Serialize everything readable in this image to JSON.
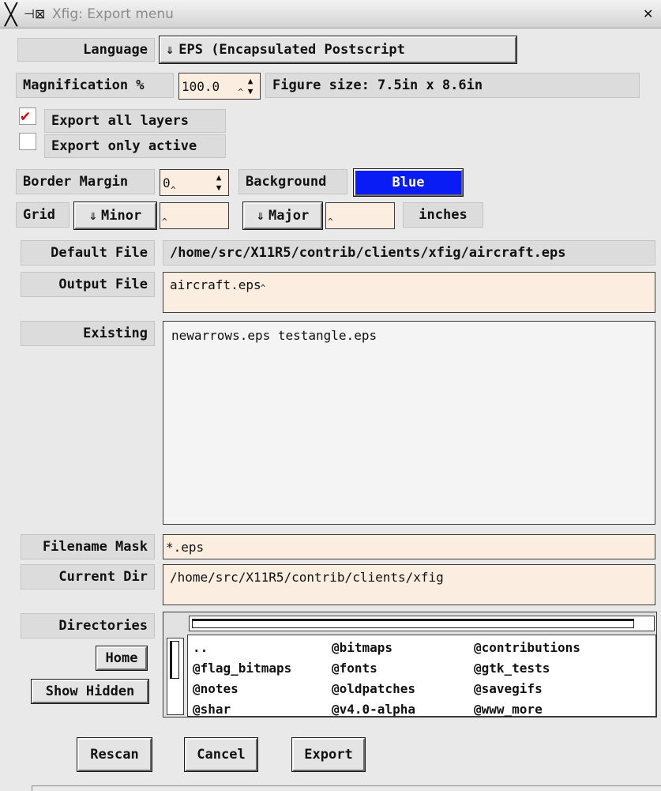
{
  "window": {
    "title": "Xfig: Export menu",
    "close_glyph": "✕",
    "app_icon": "x-logo-icon",
    "sticky_icon": "pin-icon"
  },
  "language": {
    "label": "Language",
    "value": "EPS (Encapsulated Postscript",
    "menu_icon": "menu-arrow-down-icon"
  },
  "magnification": {
    "label": "Magnification %",
    "value": "100.0",
    "figure_size": "Figure size: 7.5in x 8.6in"
  },
  "layers": {
    "export_all_label": "Export all layers",
    "export_all_checked": true,
    "export_active_label": "Export only active",
    "export_active_checked": false,
    "check_color": "#d81010"
  },
  "border": {
    "label": "Border Margin",
    "value": "0"
  },
  "background": {
    "label": "Background",
    "value": "Blue",
    "color": "#0a1cf5"
  },
  "grid": {
    "label": "Grid",
    "minor_label": "Minor",
    "minor_value": "",
    "major_label": "Major",
    "major_value": "",
    "units": "inches"
  },
  "files": {
    "default_label": "Default File",
    "default_value": "/home/src/X11R5/contrib/clients/xfig/aircraft.eps",
    "output_label": "Output File",
    "output_value": "aircraft.eps",
    "existing_label": "Existing",
    "existing_value": "newarrows.eps testangle.eps",
    "mask_label": "Filename Mask",
    "mask_value": "*.eps",
    "curdir_label": "Current Dir",
    "curdir_value": "/home/src/X11R5/contrib/clients/xfig"
  },
  "directories": {
    "label": "Directories",
    "home_label": "Home",
    "show_hidden_label": "Show Hidden",
    "items": [
      "..",
      "@bitmaps",
      "@contributions",
      "@flag_bitmaps",
      "@fonts",
      "@gtk_tests",
      "@notes",
      "@oldpatches",
      "@savegifs",
      "@shar",
      "@v4.0-alpha",
      "@www_more"
    ]
  },
  "actions": {
    "rescan_label": "Rescan",
    "cancel_label": "Cancel",
    "export_label": "Export"
  }
}
